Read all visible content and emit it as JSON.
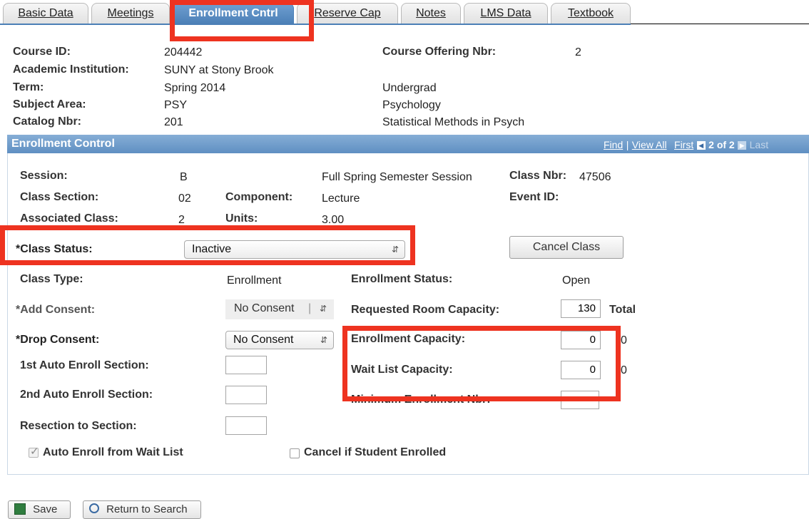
{
  "tabs": [
    {
      "label": "Basic Data"
    },
    {
      "label": "Meetings"
    },
    {
      "label": "Enrollment Cntrl"
    },
    {
      "label": "Reserve Cap"
    },
    {
      "label": "Notes"
    },
    {
      "label": "LMS Data"
    },
    {
      "label": "Textbook"
    }
  ],
  "header": {
    "course_id_label": "Course ID:",
    "course_id": "204442",
    "institution_label": "Academic Institution:",
    "institution": "SUNY at Stony Brook",
    "term_label": "Term:",
    "term": "Spring 2014",
    "career": "Undergrad",
    "subject_label": "Subject Area:",
    "subject": "PSY",
    "subject_desc": "Psychology",
    "catalog_label": "Catalog Nbr:",
    "catalog": "201",
    "catalog_desc": "Statistical Methods in Psych",
    "offering_label": "Course Offering Nbr:",
    "offering": "2"
  },
  "panel": {
    "title": "Enrollment Control",
    "nav": {
      "find": "Find",
      "view_all": "View All",
      "first": "First",
      "count": "2 of 2",
      "last": "Last"
    }
  },
  "fields": {
    "session_label": "Session:",
    "session": "B",
    "session_desc": "Full Spring Semester Session",
    "class_nbr_label": "Class Nbr:",
    "class_nbr": "47506",
    "section_label": "Class Section:",
    "section": "02",
    "component_label": "Component:",
    "component": "Lecture",
    "event_label": "Event ID:",
    "assoc_label": "Associated Class:",
    "assoc": "2",
    "units_label": "Units:",
    "units": "3.00",
    "status_label": "*Class Status:",
    "status": "Inactive",
    "cancel_class": "Cancel Class",
    "class_type_label": "Class Type:",
    "class_type": "Enrollment",
    "enroll_status_label": "Enrollment Status:",
    "enroll_status": "Open",
    "add_consent_label": "*Add Consent:",
    "add_consent": "No Consent",
    "room_cap_label": "Requested Room Capacity:",
    "room_cap": "130",
    "total_label": "Total",
    "drop_consent_label": "*Drop Consent:",
    "drop_consent": "No Consent",
    "enroll_cap_label": "Enrollment Capacity:",
    "enroll_cap": "0",
    "enroll_total": "0",
    "auto1_label": "1st Auto Enroll Section:",
    "wait_cap_label": "Wait List Capacity:",
    "wait_cap": "0",
    "wait_total": "0",
    "auto2_label": "2nd Auto Enroll Section:",
    "min_enroll_label": "Minimum Enrollment Nbr:",
    "resection_label": "Resection to Section:",
    "auto_enroll_wait": "Auto Enroll from Wait List",
    "cancel_if_enrolled": "Cancel if Student Enrolled"
  },
  "footer": {
    "save": "Save",
    "return": "Return to Search"
  },
  "colors": {
    "accent": "#4b7fb6",
    "highlight": "#ee3320"
  }
}
